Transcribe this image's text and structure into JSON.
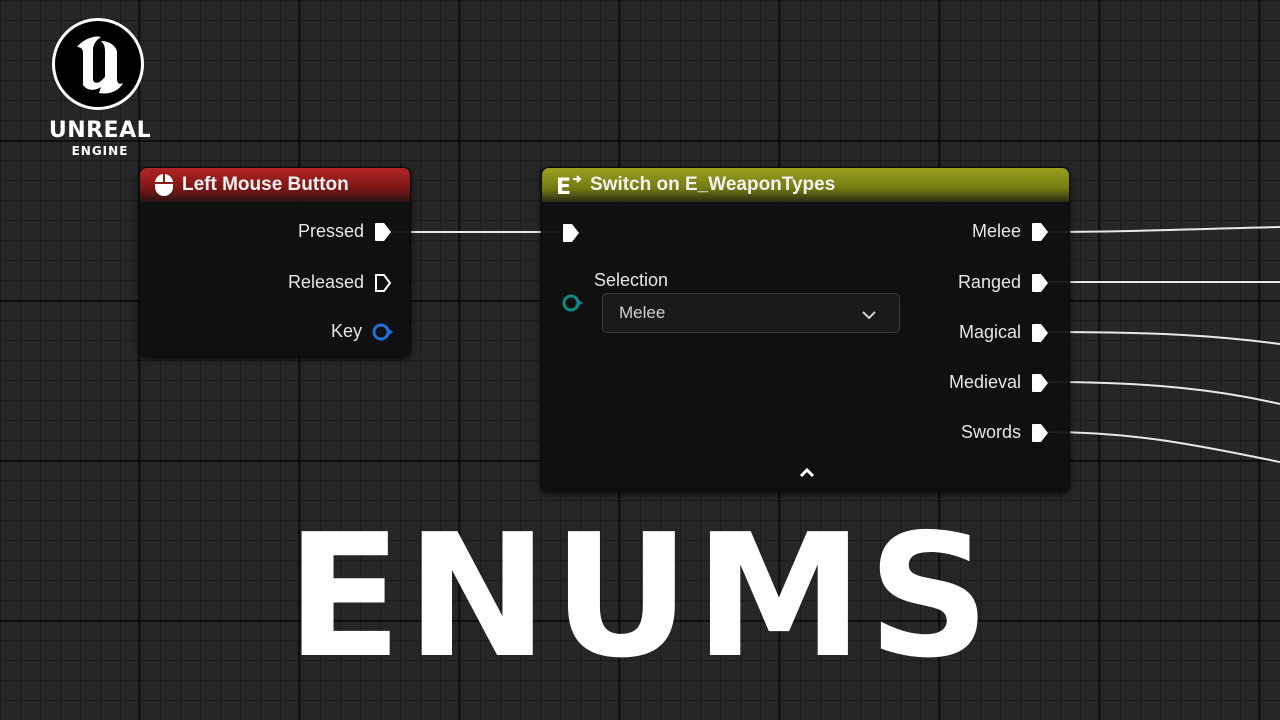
{
  "logo": {
    "word": "UNREAL",
    "sub": "ENGINE"
  },
  "input_node": {
    "title": "Left Mouse Button",
    "pins": [
      {
        "label": "Pressed",
        "kind": "exec-filled"
      },
      {
        "label": "Released",
        "kind": "exec-hollow"
      },
      {
        "label": "Key",
        "kind": "data-blue"
      }
    ],
    "header_color": "#9e1f1f"
  },
  "switch_node": {
    "title": "Switch on E_WeaponTypes",
    "selection_label": "Selection",
    "selection_value": "Melee",
    "outputs": [
      "Melee",
      "Ranged",
      "Magical",
      "Medieval",
      "Swords"
    ],
    "header_color": "#8b9219"
  },
  "title": "ENUMS",
  "colors": {
    "key_pin": "#1f6fd6",
    "selection_pin": "#0f8a83",
    "wire": "#e8e8e8"
  }
}
